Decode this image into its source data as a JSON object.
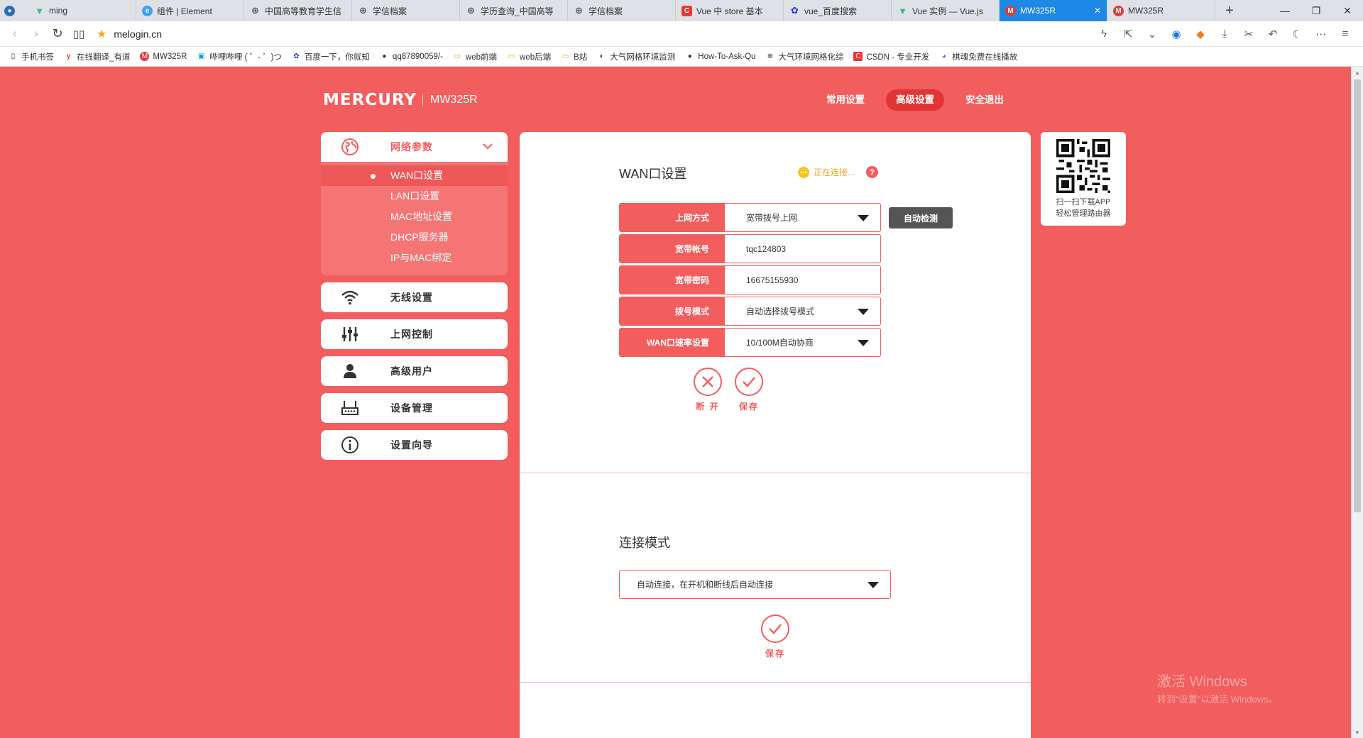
{
  "browser": {
    "tabs": [
      {
        "label": "",
        "icon": "globe-icon",
        "active": false
      },
      {
        "label": "ming",
        "icon": "vue-icon",
        "active": false
      },
      {
        "label": "组件 | Element",
        "icon": "element-icon",
        "active": false
      },
      {
        "label": "中国高等教育学生信",
        "icon": "globe-icon",
        "active": false
      },
      {
        "label": "学信档案",
        "icon": "globe-icon",
        "active": false
      },
      {
        "label": "学历查询_中国高等",
        "icon": "globe-icon",
        "active": false
      },
      {
        "label": "学信档案",
        "icon": "globe-icon",
        "active": false
      },
      {
        "label": "Vue 中 store 基本",
        "icon": "csdn-icon",
        "active": false
      },
      {
        "label": "vue_百度搜索",
        "icon": "baidu-icon",
        "active": false
      },
      {
        "label": "Vue 实例 — Vue.js",
        "icon": "vue-icon",
        "active": false
      },
      {
        "label": "MW325R",
        "icon": "mercury-icon",
        "active": true
      },
      {
        "label": "MW325R",
        "icon": "mercury-icon",
        "active": false
      }
    ],
    "url": "melogin.cn",
    "bookmarks": [
      {
        "label": "手机书签",
        "icon": "phone-icon"
      },
      {
        "label": "在线翻译_有道",
        "icon": "youdao-icon"
      },
      {
        "label": "MW325R",
        "icon": "mercury-icon"
      },
      {
        "label": "哔哩哔哩 ( ゜- ゜)つ",
        "icon": "bilibili-icon"
      },
      {
        "label": "百度一下，你就知",
        "icon": "baidu-icon"
      },
      {
        "label": "qq87890059/-",
        "icon": "github-icon"
      },
      {
        "label": "web前端",
        "icon": "folder-icon"
      },
      {
        "label": "web后端",
        "icon": "folder-icon"
      },
      {
        "label": "B站",
        "icon": "folder-icon"
      },
      {
        "label": "大气网格环境监测",
        "icon": "monitor-icon"
      },
      {
        "label": "How-To-Ask-Qu",
        "icon": "github-icon"
      },
      {
        "label": "大气环境网格化综",
        "icon": "globe-icon"
      },
      {
        "label": "CSDN - 专业开发",
        "icon": "csdn-icon"
      },
      {
        "label": "棋魂免费在线播放",
        "icon": "video-icon"
      }
    ]
  },
  "router": {
    "brand": "MERCURY",
    "model": "MW325R",
    "topnav": [
      {
        "label": "常用设置",
        "active": false
      },
      {
        "label": "高级设置",
        "active": true
      },
      {
        "label": "安全退出",
        "active": false
      }
    ],
    "sidebar": {
      "open_group": {
        "label": "网络参数",
        "icon": "globe-icon",
        "items": [
          {
            "label": "WAN口设置",
            "active": true
          },
          {
            "label": "LAN口设置",
            "active": false
          },
          {
            "label": "MAC地址设置",
            "active": false
          },
          {
            "label": "DHCP服务器",
            "active": false
          },
          {
            "label": "IP与MAC绑定",
            "active": false
          }
        ]
      },
      "groups": [
        {
          "label": "无线设置",
          "icon": "wifi-icon"
        },
        {
          "label": "上网控制",
          "icon": "sliders-icon"
        },
        {
          "label": "高级用户",
          "icon": "user-icon"
        },
        {
          "label": "设备管理",
          "icon": "router-icon"
        },
        {
          "label": "设置向导",
          "icon": "info-icon"
        }
      ]
    },
    "wan": {
      "title": "WAN口设置",
      "status": "正在连接...",
      "fields": [
        {
          "label": "上网方式",
          "value": "宽带拨号上网",
          "type": "select"
        },
        {
          "label": "宽带帐号",
          "value": "tqc124803",
          "type": "input"
        },
        {
          "label": "宽带密码",
          "value": "16675155930",
          "type": "input"
        },
        {
          "label": "拨号模式",
          "value": "自动选择拨号模式",
          "type": "select"
        },
        {
          "label": "WAN口速率设置",
          "value": "10/100M自动协商",
          "type": "select"
        }
      ],
      "auto_detect": "自动检测",
      "disconnect": "断 开",
      "save": "保存"
    },
    "connect_mode": {
      "title": "连接模式",
      "value": "自动连接，在开机和断线后自动连接",
      "save": "保存"
    },
    "qr": {
      "line1": "扫一扫下载APP",
      "line2": "轻松管理路由器"
    },
    "accent": "#f25d5d"
  },
  "watermark": {
    "line1": "激活 Windows",
    "line2": "转到\"设置\"以激活 Windows。"
  }
}
